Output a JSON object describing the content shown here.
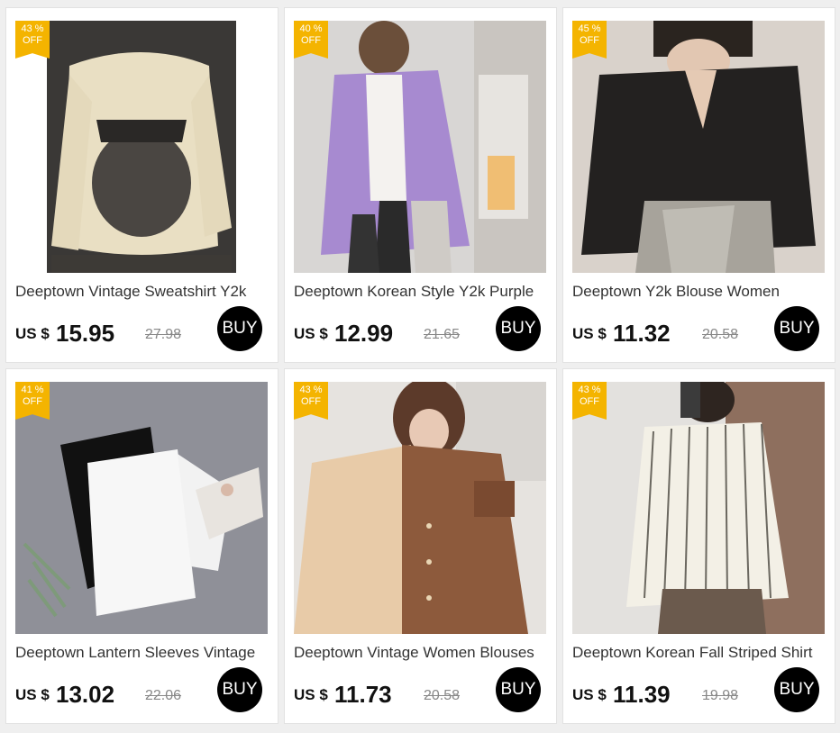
{
  "currency_label": "US $",
  "buy_label": "BUY",
  "products": [
    {
      "title": "Deeptown Vintage Sweatshirt Y2k",
      "price": "15.95",
      "old_price": "27.98",
      "discount": "43 %",
      "off": "OFF"
    },
    {
      "title": "Deeptown Korean Style Y2k Purple",
      "price": "12.99",
      "old_price": "21.65",
      "discount": "40 %",
      "off": "OFF"
    },
    {
      "title": "Deeptown Y2k Blouse Women",
      "price": "11.32",
      "old_price": "20.58",
      "discount": "45 %",
      "off": "OFF"
    },
    {
      "title": "Deeptown Lantern Sleeves Vintage",
      "price": "13.02",
      "old_price": "22.06",
      "discount": "41 %",
      "off": "OFF"
    },
    {
      "title": "Deeptown Vintage Women Blouses",
      "price": "11.73",
      "old_price": "20.58",
      "discount": "43 %",
      "off": "OFF"
    },
    {
      "title": "Deeptown Korean Fall Striped Shirt",
      "price": "11.39",
      "old_price": "19.98",
      "discount": "43 %",
      "off": "OFF"
    }
  ]
}
